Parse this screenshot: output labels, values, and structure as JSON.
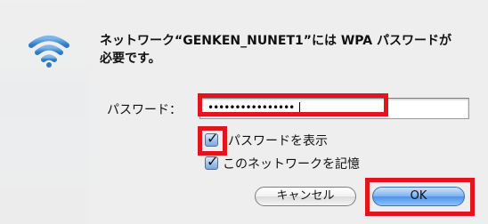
{
  "dialog": {
    "title": "ネットワーク“GENKEN_NUNET1”には WPA パスワードが必要です。",
    "password_label": "パスワード：",
    "password_value": "••••••••••••••••",
    "show_password_label": "パスワードを表示",
    "show_password_checked": true,
    "remember_network_label": "このネットワークを記憶",
    "remember_network_checked": true,
    "cancel_label": "キャンセル",
    "ok_label": "OK"
  },
  "icons": {
    "network": "wifi-icon",
    "check": "check-icon"
  },
  "colors": {
    "highlight": "#e0161c",
    "ok_button": "#4d95ea",
    "checkbox": "#9fc2ec"
  }
}
